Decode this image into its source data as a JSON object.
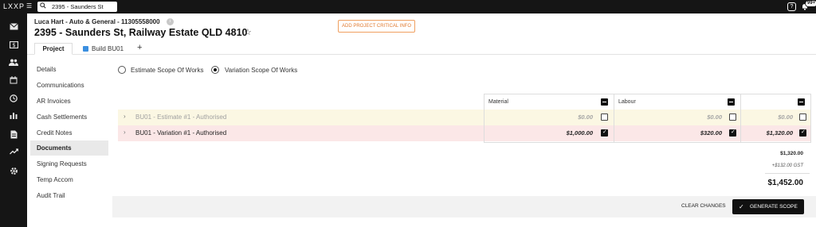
{
  "topbar": {
    "logo": "LXXP",
    "menu_icon": "menu-collapse-icon",
    "search_value": "2395 - Saunders St",
    "help_icon": "help-icon",
    "notification_count": "99+"
  },
  "rail": {
    "icons": [
      "mail-icon",
      "dollar-icon",
      "users-icon",
      "calendar-icon",
      "clock-icon",
      "bar-chart-icon",
      "document-icon",
      "trend-icon",
      "gear-icon"
    ]
  },
  "header": {
    "client": "Luca Hart - Auto & General - 11305558000",
    "address": "2395 - Saunders St, Railway Estate QLD 4810",
    "critical_button": "ADD PROJECT CRITICAL INFO"
  },
  "tabs": {
    "project": "Project",
    "build": "Build BU01",
    "add": "+"
  },
  "nav": {
    "items": [
      "Details",
      "Communications",
      "AR Invoices",
      "Cash Settlements",
      "Credit Notes",
      "Documents",
      "Signing Requests",
      "Temp Accom",
      "Audit Trail"
    ],
    "active": "Documents"
  },
  "scope": {
    "option_estimate": "Estimate Scope Of Works",
    "option_variation": "Variation Scope Of Works",
    "selected": "Variation Scope Of Works"
  },
  "table": {
    "headers": [
      "Material",
      "Labour",
      ""
    ],
    "rows": [
      {
        "label": "BU01 - Estimate #1 - Authorised",
        "material": "$0.00",
        "labour": "$0.00",
        "total": "$0.00",
        "checked": false
      },
      {
        "label": "BU01 - Variation #1 - Authorised",
        "material": "$1,000.00",
        "labour": "$320.00",
        "total": "$1,320.00",
        "checked": true
      }
    ]
  },
  "totals": {
    "subtotal": "$1,320.00",
    "gst": "+$132.00 GST",
    "total": "$1,452.00"
  },
  "footer": {
    "clear": "CLEAR CHANGES",
    "generate": "GENERATE SCOPE"
  }
}
